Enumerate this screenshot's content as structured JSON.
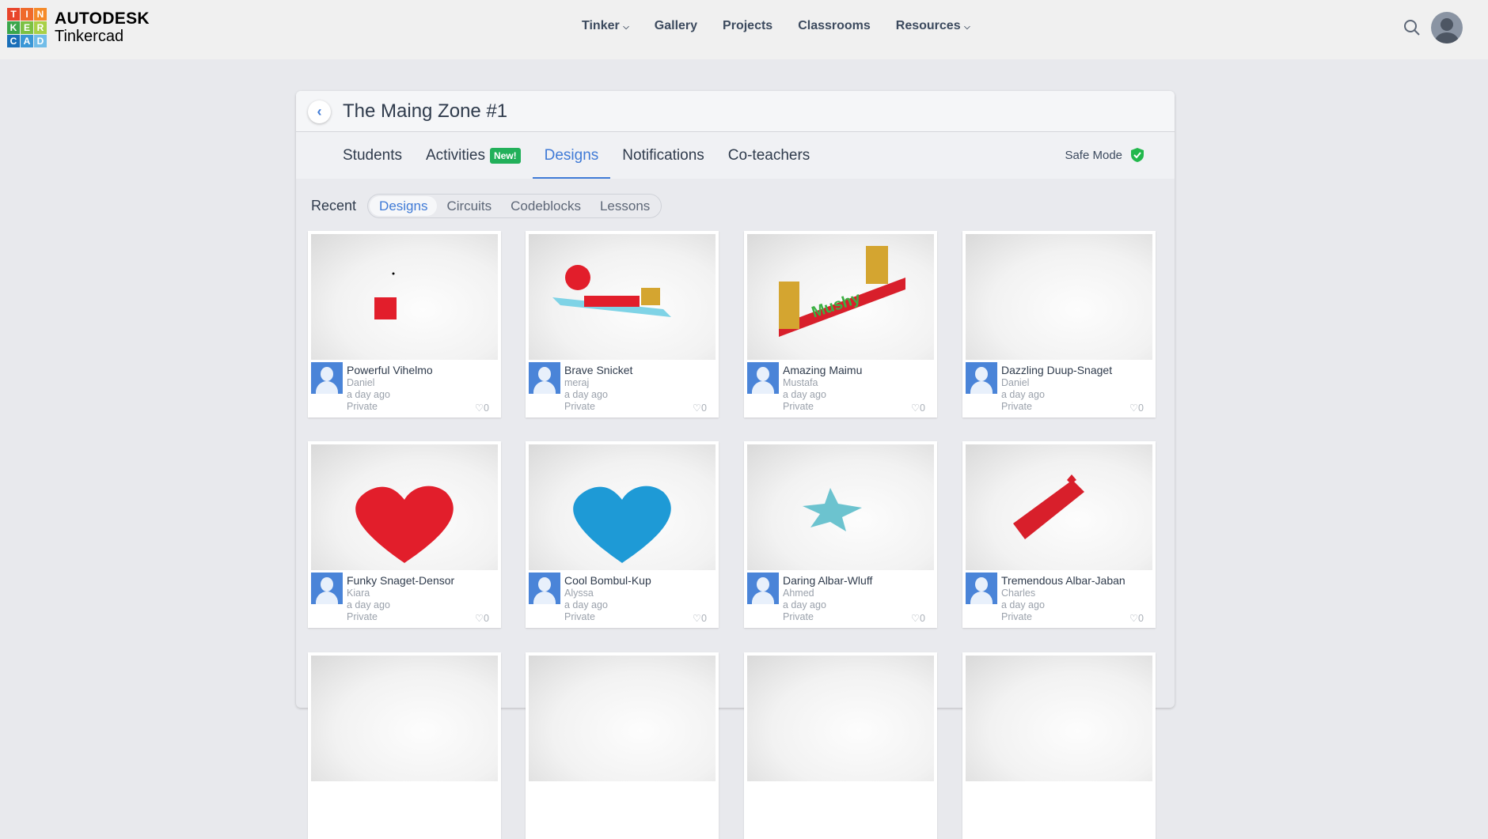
{
  "header": {
    "logo_letters": [
      "T",
      "I",
      "N",
      "K",
      "E",
      "R",
      "C",
      "A",
      "D"
    ],
    "logo_colors": [
      "#e8442b",
      "#ef6a2b",
      "#f58a29",
      "#3aa64b",
      "#7cc143",
      "#a9d046",
      "#1a6fb8",
      "#3a97d6",
      "#72bde8"
    ],
    "brand": "AUTODESK",
    "product": "Tinkercad",
    "nav": [
      "Tinker",
      "Gallery",
      "Projects",
      "Classrooms",
      "Resources"
    ]
  },
  "classroom": {
    "title": "The Maing Zone #1",
    "tabs": [
      "Students",
      "Activities",
      "Designs",
      "Notifications",
      "Co-teachers"
    ],
    "new_badge": "New!",
    "active_tab": "Designs",
    "safe_mode": "Safe Mode"
  },
  "filters": {
    "label": "Recent",
    "options": [
      "Designs",
      "Circuits",
      "Codeblocks",
      "Lessons"
    ],
    "active": "Designs"
  },
  "designs": [
    {
      "name": "Powerful Vihelmo",
      "author": "Daniel",
      "time": "a day ago",
      "visibility": "Private",
      "likes": "0",
      "color": "#e21e2b"
    },
    {
      "name": "Brave Snicket",
      "author": "meraj",
      "time": "a day ago",
      "visibility": "Private",
      "likes": "0",
      "color": "#e21e2b"
    },
    {
      "name": "Amazing Maimu",
      "author": "Mustafa",
      "time": "a day ago",
      "visibility": "Private",
      "likes": "0",
      "color": "#d4a530"
    },
    {
      "name": "Dazzling Duup-Snaget",
      "author": "Daniel",
      "time": "a day ago",
      "visibility": "Private",
      "likes": "0",
      "color": ""
    },
    {
      "name": "Funky Snaget-Densor",
      "author": "Kiara",
      "time": "a day ago",
      "visibility": "Private",
      "likes": "0",
      "color": "#e21e2b"
    },
    {
      "name": "Cool Bombul-Kup",
      "author": "Alyssa",
      "time": "a day ago",
      "visibility": "Private",
      "likes": "0",
      "color": "#1e9ad6"
    },
    {
      "name": "Daring Albar-Wluff",
      "author": "Ahmed",
      "time": "a day ago",
      "visibility": "Private",
      "likes": "0",
      "color": "#6cc3cf"
    },
    {
      "name": "Tremendous Albar-Jaban",
      "author": "Charles",
      "time": "a day ago",
      "visibility": "Private",
      "likes": "0",
      "color": "#d81f2b"
    }
  ]
}
